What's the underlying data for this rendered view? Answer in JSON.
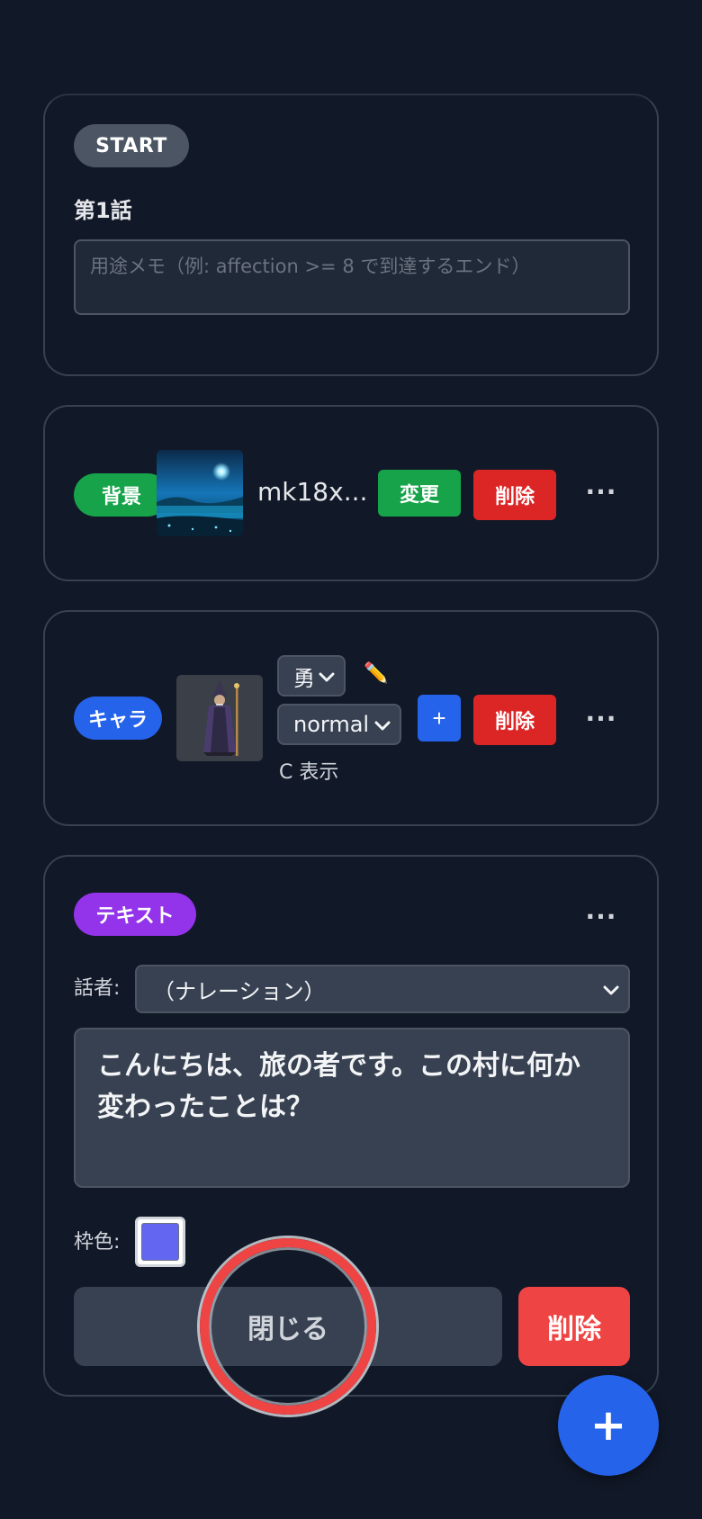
{
  "start_card": {
    "badge": "START",
    "title": "第1話",
    "memo_placeholder": "用途メモ（例: affection >= 8 で到達するエンド）"
  },
  "background_card": {
    "badge": "背景",
    "filename": "mk18x...",
    "change_label": "変更",
    "delete_label": "削除",
    "more_label": "···"
  },
  "chara_card": {
    "badge": "キャラ",
    "name_select_value": "勇",
    "expression_select_value": "normal",
    "add_label": "+",
    "delete_label": "削除",
    "position_label": "C 表示",
    "more_label": "···",
    "pencil_icon": "✏️"
  },
  "text_card": {
    "badge": "テキスト",
    "more_label": "···",
    "speaker_label": "話者:",
    "speaker_value": "（ナレーション）",
    "dialogue": "こんにちは、旅の者です。この村に何か変わったことは？",
    "frame_color_label": "枠色:",
    "frame_color": "#6366f1",
    "close_label": "閉じる",
    "delete_label": "削除"
  },
  "fab_label": "+",
  "colors": {
    "background": "#111827",
    "card_border": "#374151",
    "start_badge": "#4b5563",
    "bg_badge": "#16a34a",
    "chara_badge": "#2563eb",
    "text_badge": "#9333ea",
    "danger": "#dc2626",
    "click_ring": "#ef4444"
  }
}
